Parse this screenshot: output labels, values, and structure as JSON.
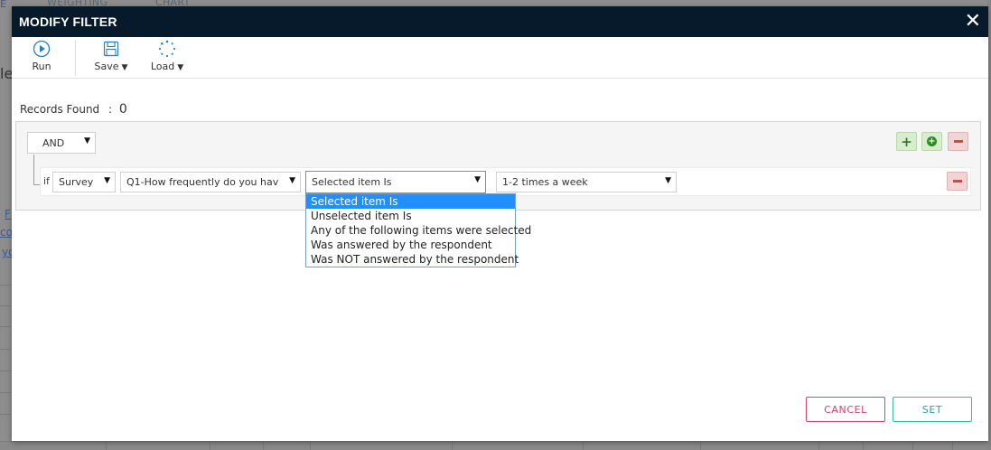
{
  "background": {
    "tabs": [
      "WEIGHTING",
      "CHART"
    ],
    "partial_left_text": [
      "E",
      "le",
      "F",
      "co",
      "yo"
    ]
  },
  "modal": {
    "title": "MODIFY FILTER",
    "close_glyph": "✕",
    "toolbar": {
      "run_label": "Run",
      "save_label": "Save",
      "load_label": "Load",
      "dropdown_caret": "▼"
    },
    "records": {
      "label": "Records Found",
      "separator": ":",
      "count": "0"
    },
    "group": {
      "operator": "AND",
      "add_rule_glyph": "+"
    },
    "rule": {
      "if_label": "if",
      "source": "Survey",
      "question": "Q1-How frequently do you hav",
      "condition": "Selected item Is",
      "value": "1-2 times a week"
    },
    "condition_options": [
      "Selected item Is",
      "Unselected item Is",
      "Any of the following items were selected",
      "Was answered by the respondent",
      "Was NOT answered by the respondent"
    ],
    "selected_condition_index": 0,
    "buttons": {
      "cancel": "CANCEL",
      "set": "SET"
    }
  },
  "colors": {
    "header_bg": "#061a2b",
    "cancel": "#d9416b",
    "set": "#2aa596",
    "add_green": "#2f7d25",
    "remove_red": "#d24747",
    "dropdown_highlight": "#1e90ff"
  }
}
